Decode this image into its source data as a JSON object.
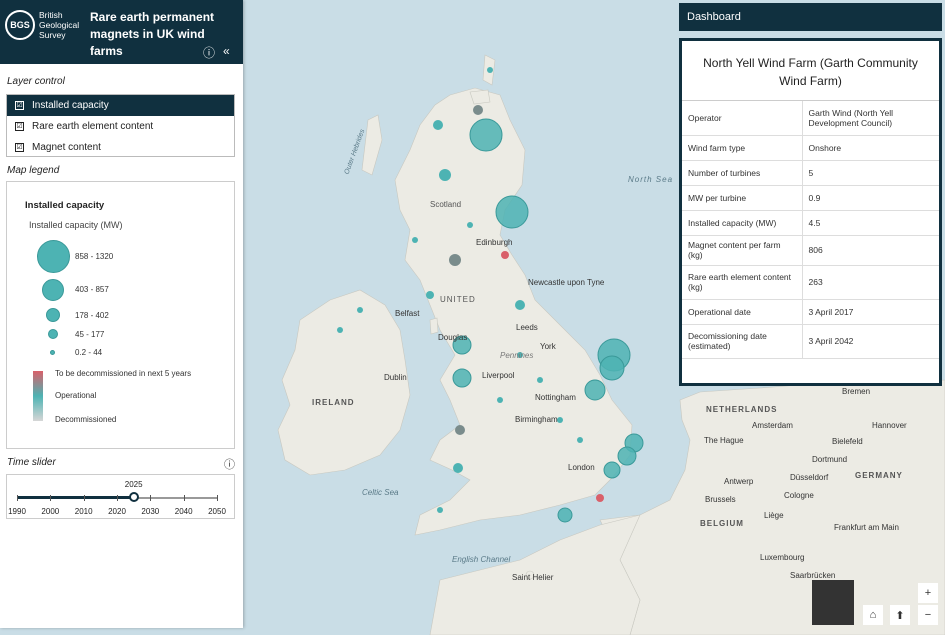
{
  "header": {
    "logo_mark": "BGS",
    "logo_text_1": "British",
    "logo_text_2": "Geological",
    "logo_text_3": "Survey",
    "title": "Rare earth permanent magnets in UK wind farms",
    "info_icon": "info-icon",
    "collapse_icon": "double-chevron-left-icon"
  },
  "layer_control": {
    "label": "Layer control",
    "items": [
      {
        "label": "Installed capacity",
        "active": true
      },
      {
        "label": "Rare earth element content",
        "active": false
      },
      {
        "label": "Magnet content",
        "active": false
      }
    ]
  },
  "legend": {
    "label": "Map legend",
    "title": "Installed capacity",
    "subtitle": "Installed capacity (MW)",
    "classes": [
      "858 - 1320",
      "403 - 857",
      "178 - 402",
      "45 - 177",
      "0.2 - 44"
    ],
    "status_labels": [
      "To be decommissioned in next 5 years",
      "Operational",
      "Decommissioned"
    ],
    "colors": {
      "operational": "#4db3b3",
      "to_be_decommissioned": "#d9606a",
      "decommissioned": "#d6d6d6"
    }
  },
  "time_slider": {
    "label": "Time slider",
    "current_year": "2025",
    "ticks": [
      "1990",
      "2000",
      "2010",
      "2020",
      "2030",
      "2040",
      "2050"
    ],
    "start_year": 1990,
    "end_year": 2050
  },
  "dashboard": {
    "label": "Dashboard",
    "title": "North Yell Wind Farm (Garth Community Wind Farm)",
    "rows": [
      {
        "key": "Operator",
        "value": "Garth Wind (North Yell Development Council)"
      },
      {
        "key": "Wind farm type",
        "value": "Onshore"
      },
      {
        "key": "Number of turbines",
        "value": "5"
      },
      {
        "key": "MW per turbine",
        "value": "0.9"
      },
      {
        "key": "Installed capacity (MW)",
        "value": "4.5"
      },
      {
        "key": "Magnet content per farm (kg)",
        "value": "806"
      },
      {
        "key": "Rare earth element content (kg)",
        "value": "263"
      },
      {
        "key": "Operational date",
        "value": "3 April 2017"
      },
      {
        "key": "Decomissioning date (estimated)",
        "value": "3 April 2042"
      }
    ]
  },
  "map": {
    "labels": [
      "North Sea",
      "Scotland",
      "Edinburgh",
      "Newcastle upon Tyne",
      "UNITED",
      "Belfast",
      "Douglas",
      "Leeds",
      "York",
      "Dublin",
      "IRELAND",
      "Liverpool",
      "Pennines",
      "Nottingham",
      "Birmingham",
      "London",
      "Celtic Sea",
      "English Channel",
      "Saint Helier",
      "NETHERLANDS",
      "Amsterdam",
      "The Hague",
      "Bremen",
      "Hannover",
      "Bielefeld",
      "Dortmund",
      "Düsseldorf",
      "Cologne",
      "GERMANY",
      "Brussels",
      "Antwerp",
      "BELGIUM",
      "Frankfurt am Main",
      "Luxembourg",
      "Saarbrücken",
      "Outer Hebrides",
      "Liège"
    ],
    "zoom_in": "+",
    "zoom_out": "−",
    "home_icon": "home-icon",
    "compass_icon": "compass-icon"
  }
}
